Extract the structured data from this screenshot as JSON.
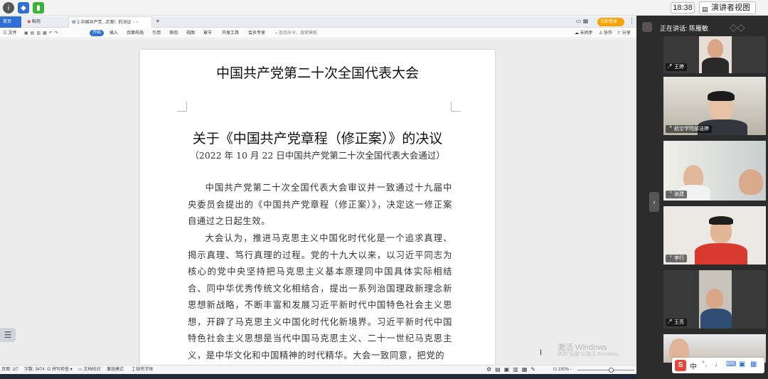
{
  "meeting_bar": {
    "clock": "18:38",
    "presenter_view": "演讲者视图"
  },
  "tabs": {
    "home": "首页",
    "daoke": "稻壳",
    "doc": "2.中国共产党...正案）的决议",
    "add": "+"
  },
  "login_label": "立即登录",
  "menu": {
    "file": "三 文件",
    "start": "开始",
    "insert": "插入",
    "layout": "页面布局",
    "reference": "引用",
    "review": "审阅",
    "view": "视图",
    "section": "章节",
    "devtools": "开发工具",
    "member": "会员专享",
    "search": "查找命令、搜索模板",
    "sync": "未同步",
    "collab": "协作",
    "share": "分享"
  },
  "document": {
    "title_line1": "中国共产党第二十次全国代表大会",
    "title_line2": "关于《中国共产党章程（修正案）》的决议",
    "subtitle": "（2022 年 10 月 22 日中国共产党第二十次全国代表大会通过）",
    "para1": "中国共产党第二十次全国代表大会审议并一致通过十九届中央委员会提出的《中国共产党章程（修正案）》，决定这一修正案自通过之日起生效。",
    "para2": "大会认为，推进马克思主义中国化时代化是一个追求真理、揭示真理、笃行真理的过程。党的十九大以来，以习近平同志为核心的党中央坚持把马克思主义基本原理同中国具体实际相结合、同中华优秀传统文化相结合，提出一系列治国理政新理念新思想新战略，不断丰富和发展习近平新时代中国特色社会主义思想，开辟了马克思主义中国化时代化新境界。习近平新时代中国特色社会主义思想是当代中国马克思主义、二十一世纪马克思主义，是中华文化和中国精神的时代精华。大会一致同意，把党的"
  },
  "watermark": {
    "line1": "激活 Windows",
    "line2": "转到\"设置\"以激活 Windows。"
  },
  "status": {
    "page": "页面: 1/7",
    "words": "字数: 3474",
    "spell": "拼写检查",
    "proof": "文档校对",
    "compat": "兼容模式",
    "missing_font": "缺失字体",
    "zoom": "130%"
  },
  "panel": {
    "speaking": "正在讲话: 陈雁敏",
    "participants": [
      "王婷",
      "航空学院部洁婷",
      "张建",
      "李行",
      "王亮"
    ]
  },
  "ime": {
    "lang": "中"
  }
}
